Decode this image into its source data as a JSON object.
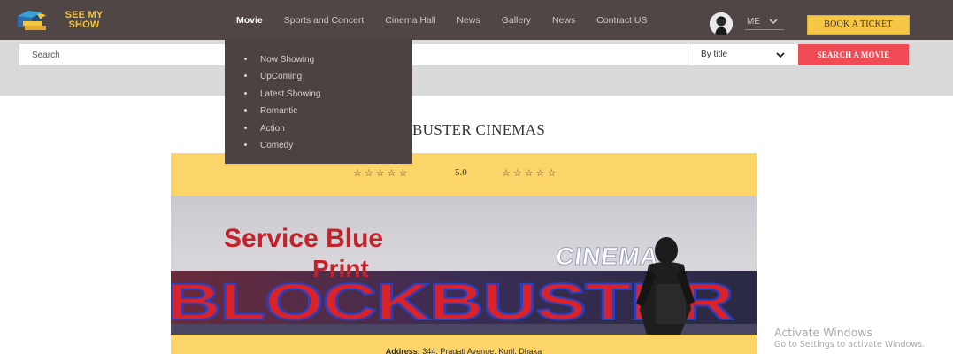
{
  "brand": {
    "logo_text_line1": "SEE MY",
    "logo_text_line2": "SHOW"
  },
  "nav": {
    "items": [
      {
        "label": "Movie",
        "active": true
      },
      {
        "label": "Sports and Concert"
      },
      {
        "label": "Cinema Hall"
      },
      {
        "label": "News"
      },
      {
        "label": "Gallery"
      },
      {
        "label": "News"
      },
      {
        "label": "Contract US"
      }
    ],
    "user_menu_label": "ME",
    "book_button": "BOOK A TICKET"
  },
  "search": {
    "placeholder": "Search",
    "filter_value": "By title",
    "button": "SEARCH A MOVIE"
  },
  "movie_dropdown": {
    "items": [
      "Now Showing",
      "UpComing",
      "Latest Showing",
      "Romantic",
      "Action",
      "Comedy"
    ]
  },
  "cinema": {
    "title_visible": "BUSTER CINEMAS",
    "stars_left": "☆☆☆☆☆",
    "score": "5.0",
    "stars_right": "☆☆☆☆☆",
    "photo_text_line1": "Service Blue",
    "photo_text_line2": "Print",
    "sign_cinemas": "CINEMAS",
    "sign_blockbuster": "BLOCKBUSTER",
    "address_label": "Address:",
    "address_value": "344, Pragati Avenue, Kuril, Dhaka"
  },
  "watermark": {
    "line1": "Activate Windows",
    "line2": "Go to Settings to activate Windows."
  },
  "colors": {
    "nav_bg": "#514646",
    "dropdown_bg": "#4d4242",
    "accent_yellow": "#f6c647",
    "card_yellow": "#fcd56a",
    "search_red": "#f04a54"
  }
}
